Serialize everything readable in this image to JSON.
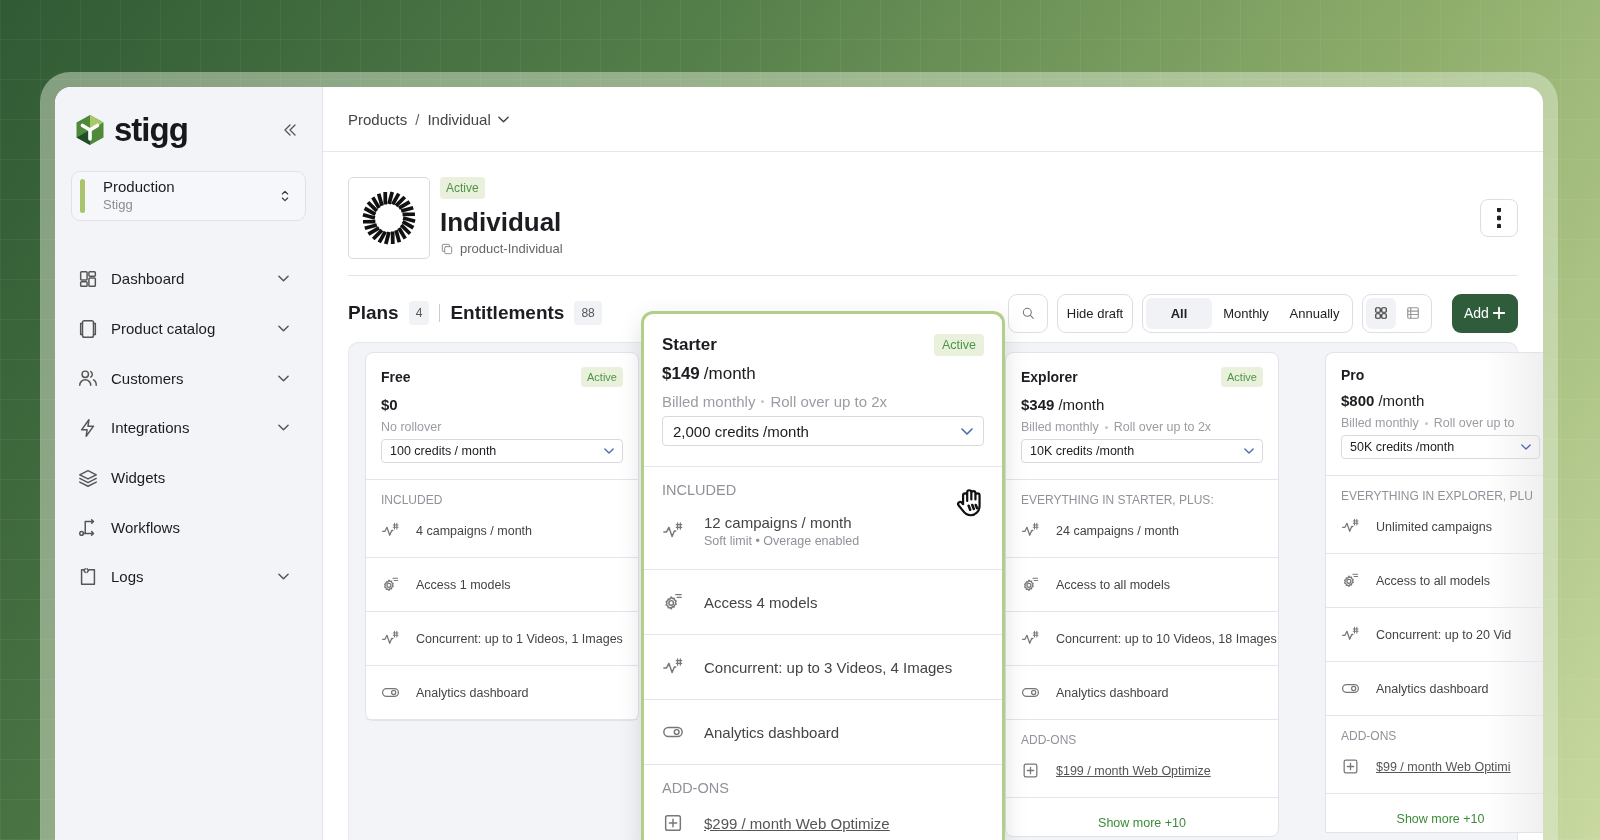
{
  "sidebar": {
    "logo": "stigg",
    "environment": {
      "name": "Production",
      "org": "Stigg"
    },
    "items": [
      {
        "label": "Dashboard",
        "kind": "dashboard",
        "expandable": true
      },
      {
        "label": "Product catalog",
        "kind": "catalog",
        "expandable": true
      },
      {
        "label": "Customers",
        "kind": "customers",
        "expandable": true
      },
      {
        "label": "Integrations",
        "kind": "integrations",
        "expandable": true
      },
      {
        "label": "Widgets",
        "kind": "widgets",
        "expandable": false
      },
      {
        "label": "Workflows",
        "kind": "workflows",
        "expandable": false
      },
      {
        "label": "Logs",
        "kind": "logs",
        "expandable": true
      }
    ]
  },
  "breadcrumb": [
    "Products",
    "/",
    "Individual"
  ],
  "product": {
    "status": "Active",
    "name": "Individual",
    "id": "product-Individual"
  },
  "tabs": [
    {
      "label": "Plans",
      "count": "4"
    },
    {
      "label": "Entitlements",
      "count": "88"
    }
  ],
  "toolbar": {
    "hide_draft": "Hide draft",
    "periods": [
      {
        "label": "All",
        "selected": true
      },
      {
        "label": "Monthly",
        "selected": false
      },
      {
        "label": "Annually",
        "selected": false
      }
    ],
    "views": [
      {
        "kind": "grid",
        "selected": true
      },
      {
        "kind": "table",
        "selected": false
      }
    ],
    "add": "Add"
  },
  "plans": [
    {
      "name": "Free",
      "status": "Active",
      "price": "$0",
      "billing": [
        "No rollover"
      ],
      "credits": "100 credits / month",
      "section": "INCLUDED",
      "highlighted": false,
      "features": [
        {
          "kind": "limit",
          "text": "4 campaigns / month"
        },
        {
          "kind": "models",
          "text": "Access 1 models"
        },
        {
          "kind": "limit",
          "text": "Concurrent: up to 1 Videos, 1 Images"
        },
        {
          "kind": "toggle",
          "text": "Analytics dashboard"
        }
      ]
    },
    {
      "name": "Starter",
      "status": "Active",
      "price": "$149",
      "period": "/month",
      "billing": [
        "Billed monthly",
        "Roll over up to 2x"
      ],
      "credits": "2,000 credits /month",
      "section": "INCLUDED",
      "highlighted": true,
      "features": [
        {
          "kind": "limit",
          "text": "12 campaigns / month",
          "note": "Soft limit • Overage enabled"
        },
        {
          "kind": "models",
          "text": "Access 4 models"
        },
        {
          "kind": "limit",
          "text": "Concurrent: up to 3 Videos, 4 Images"
        },
        {
          "kind": "toggle",
          "text": "Analytics dashboard"
        }
      ],
      "addons_title": "ADD-ONS",
      "addons": [
        "$299 / month Web Optimize"
      ]
    },
    {
      "name": "Explorer",
      "status": "Active",
      "price": "$349",
      "period": "/month",
      "billing": [
        "Billed monthly",
        "Roll over up to 2x"
      ],
      "credits": "10K credits /month",
      "section": "EVERYTHING IN STARTER, PLUS:",
      "highlighted": false,
      "features": [
        {
          "kind": "limit",
          "text": "24 campaigns / month"
        },
        {
          "kind": "models",
          "text": "Access to all models"
        },
        {
          "kind": "limit",
          "text": "Concurrent: up to 10 Videos, 18 Images"
        },
        {
          "kind": "toggle",
          "text": "Analytics dashboard"
        }
      ],
      "addons_title": "ADD-ONS",
      "addons": [
        "$199 / month Web Optimize"
      ],
      "show_more": "Show more +10"
    },
    {
      "name": "Pro",
      "price": "$800",
      "period": "/month",
      "billing": [
        "Billed monthly",
        "Roll over up to"
      ],
      "credits": "50K credits /month",
      "section": "EVERYTHING IN EXPLORER, PLU",
      "highlighted": false,
      "features": [
        {
          "kind": "limit",
          "text": "Unlimited campaigns"
        },
        {
          "kind": "models",
          "text": "Access to all models"
        },
        {
          "kind": "limit",
          "text": "Concurrent: up to 20 Vid"
        },
        {
          "kind": "toggle",
          "text": "Analytics dashboard"
        }
      ],
      "addons_title": "ADD-ONS",
      "addons": [
        "$99 / month Web Optimi"
      ],
      "show_more": "Show more +10"
    }
  ]
}
